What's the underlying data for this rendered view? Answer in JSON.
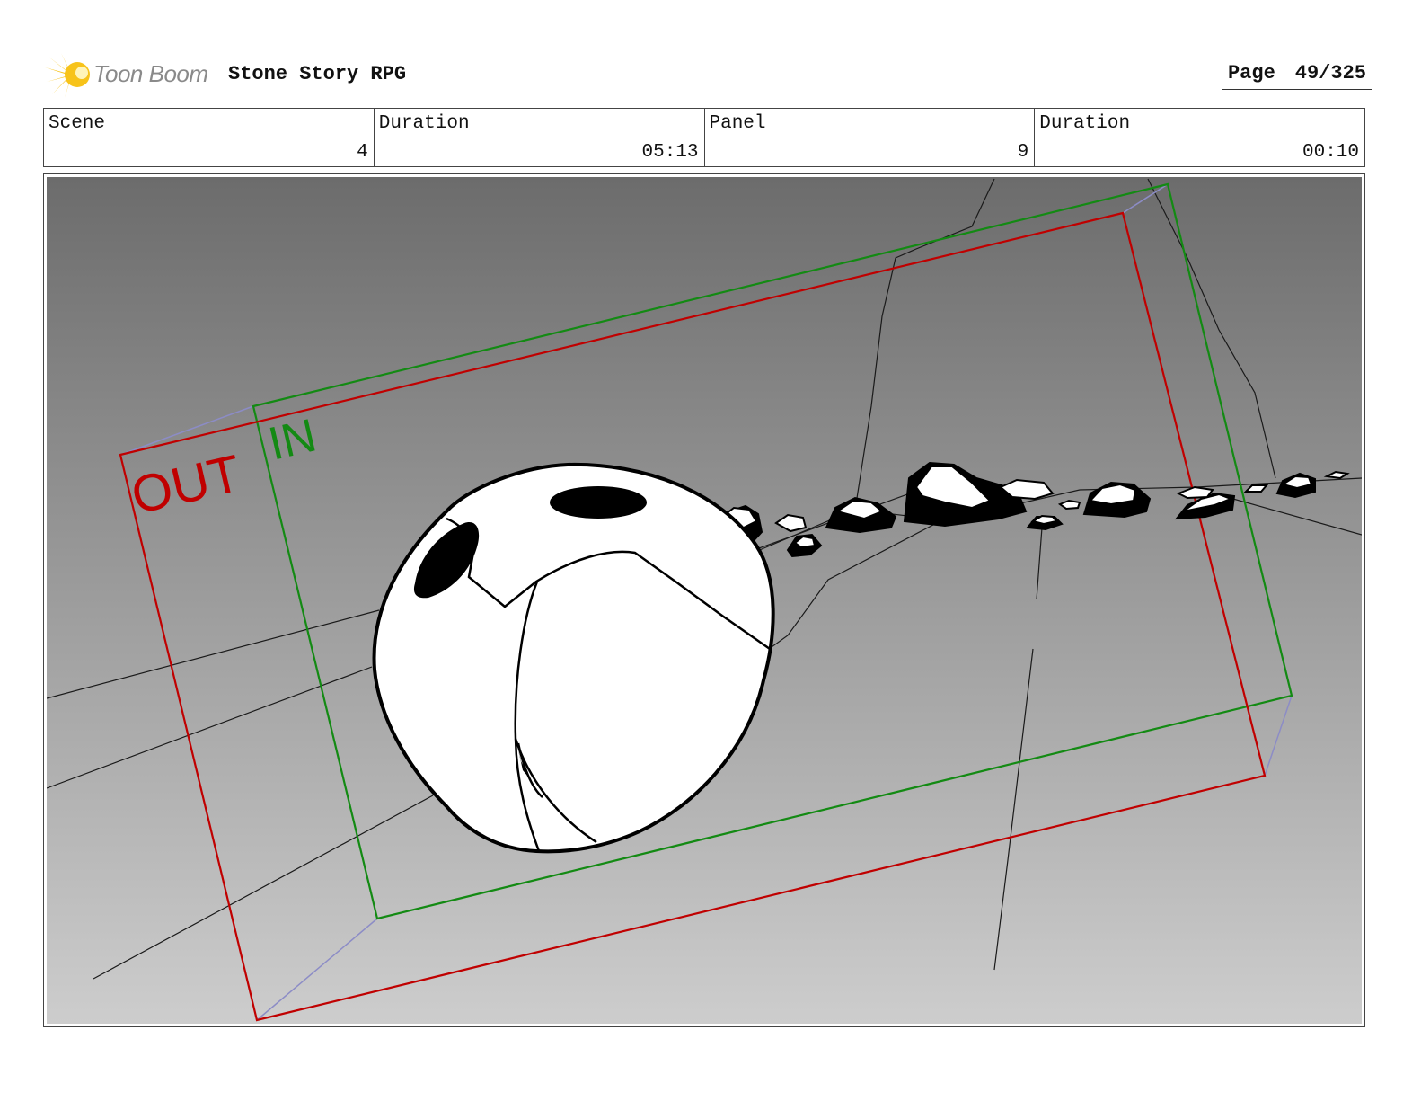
{
  "header": {
    "logo_text": "Toon Boom",
    "project_title": "Stone Story RPG",
    "page_label": "Page",
    "page_number": "49/325"
  },
  "info": {
    "scene_label": "Scene",
    "scene_value": "4",
    "scene_duration_label": "Duration",
    "scene_duration_value": "05:13",
    "panel_label": "Panel",
    "panel_value": "9",
    "panel_duration_label": "Duration",
    "panel_duration_value": "00:10"
  },
  "panel": {
    "out_label": "OUT",
    "in_label": "IN",
    "out_color": "#c00000",
    "in_color": "#138a13",
    "background_top": "#6c6c6c",
    "background_bottom": "#cdcdcd"
  },
  "colors": {
    "logo_accent": "#f7c31a",
    "logo_text": "#8a8a8a"
  }
}
